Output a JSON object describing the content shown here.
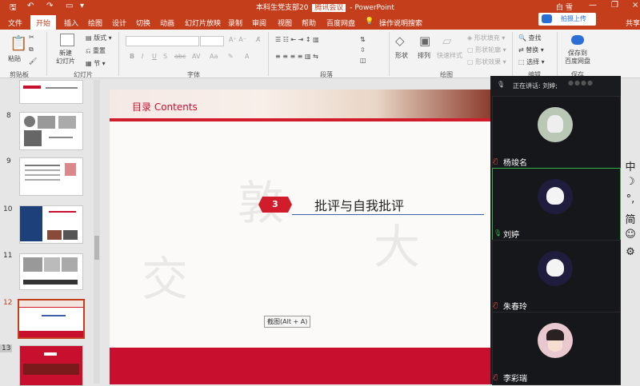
{
  "titlebar": {
    "title": "本科生党支部20",
    "meeting": "腾讯会议",
    "app": "PowerPoint",
    "user": "白 雪"
  },
  "tabs": [
    "文件",
    "开始",
    "插入",
    "绘图",
    "设计",
    "切换",
    "动画",
    "幻灯片放映",
    "录制",
    "审阅",
    "视图",
    "帮助",
    "百度网盘",
    "操作说明搜索"
  ],
  "active_tab": "开始",
  "upload_label": "拍摄上传",
  "share_label": "共享",
  "ribbon": {
    "paste": "粘贴",
    "clipboard": "剪贴板",
    "new_slide": "新建\n幻灯片",
    "layout": "版式",
    "reset": "重置",
    "section": "节",
    "slides_group": "幻灯片",
    "font_group": "字体",
    "paragraph_group": "段落",
    "shape": "形状",
    "arrange": "排列",
    "quick_style": "快速样式",
    "fill": "形状填充",
    "outline": "形状轮廓",
    "effect": "形状效果",
    "drawing_group": "绘图",
    "find": "查找",
    "replace": "替换",
    "select": "选择",
    "edit_group": "编辑",
    "save_baidu": "保存到\n百度网盘",
    "save_group": "保存"
  },
  "thumbnails": [
    {
      "num": "8"
    },
    {
      "num": "9"
    },
    {
      "num": "10"
    },
    {
      "num": "11"
    },
    {
      "num": "12"
    },
    {
      "num": "13"
    }
  ],
  "slide": {
    "header": "目录 Contents",
    "section_number": "3",
    "section_title": "批评与自我批评"
  },
  "tooltip": "截图(Alt + A)",
  "meeting": {
    "speaking": "正在讲话: 刘婷;",
    "participants": [
      {
        "name": "杨竣名",
        "muted": true
      },
      {
        "name": "刘婷",
        "muted": false
      },
      {
        "name": "朱春玲",
        "muted": true
      },
      {
        "name": "李彩瑞",
        "muted": true
      }
    ]
  },
  "ime": [
    "中",
    "☽",
    "°,",
    "简",
    "☺",
    "⚙"
  ],
  "colors": {
    "accent": "#c43e1c",
    "slide_red": "#c8102e",
    "active_speaker": "#32b24b"
  }
}
